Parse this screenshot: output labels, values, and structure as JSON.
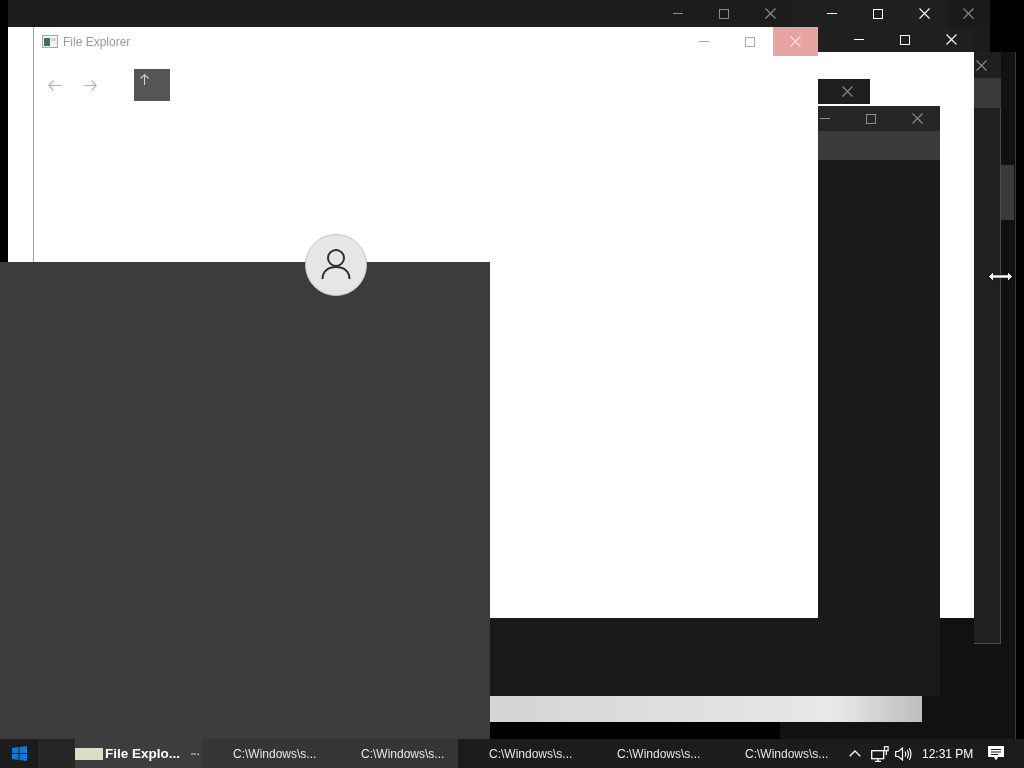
{
  "windows": [
    {
      "active": false,
      "controls": [
        {
          "kind": "close"
        }
      ]
    },
    {
      "active": true,
      "controls": [
        {
          "kind": "minimize"
        },
        {
          "kind": "maximize"
        },
        {
          "kind": "close"
        }
      ]
    },
    {
      "active": false,
      "controls": [
        {
          "kind": "minimize"
        },
        {
          "kind": "maximize"
        },
        {
          "kind": "close"
        }
      ]
    },
    {
      "active": false,
      "controls": [
        {
          "kind": "close"
        }
      ]
    },
    {
      "active": true,
      "controls": [
        {
          "kind": "minimize"
        },
        {
          "kind": "maximize"
        },
        {
          "kind": "close"
        }
      ]
    },
    {
      "active": false,
      "controls": [
        {
          "kind": "close"
        }
      ]
    },
    {
      "active": false,
      "controls": [
        {
          "kind": "minimize"
        },
        {
          "kind": "maximize"
        },
        {
          "kind": "close"
        }
      ]
    }
  ],
  "file_explorer": {
    "title": "File Explorer",
    "active": false,
    "controls": [
      {
        "kind": "minimize",
        "hovered": false
      },
      {
        "kind": "maximize",
        "hovered": false
      },
      {
        "kind": "close",
        "hovered": true
      }
    ],
    "nav": [
      {
        "kind": "back",
        "disabled": true,
        "highlighted": false
      },
      {
        "kind": "forward",
        "disabled": true,
        "highlighted": false
      },
      {
        "kind": "up",
        "disabled": false,
        "highlighted": true
      }
    ]
  },
  "taskbar": {
    "tasks": [
      {
        "label": "File Explo...",
        "selected": true,
        "highlighted": false
      },
      {
        "label": "C:\\Windows\\s...",
        "selected": false,
        "highlighted": true
      },
      {
        "label": "C:\\Windows\\s...",
        "selected": false,
        "highlighted": true
      },
      {
        "label": "C:\\Windows\\s...",
        "selected": false,
        "highlighted": false
      },
      {
        "label": "C:\\Windows\\s...",
        "selected": false,
        "highlighted": false
      },
      {
        "label": "C:\\Windows\\s...",
        "selected": false,
        "highlighted": false
      }
    ],
    "clock": "12:31 PM"
  }
}
